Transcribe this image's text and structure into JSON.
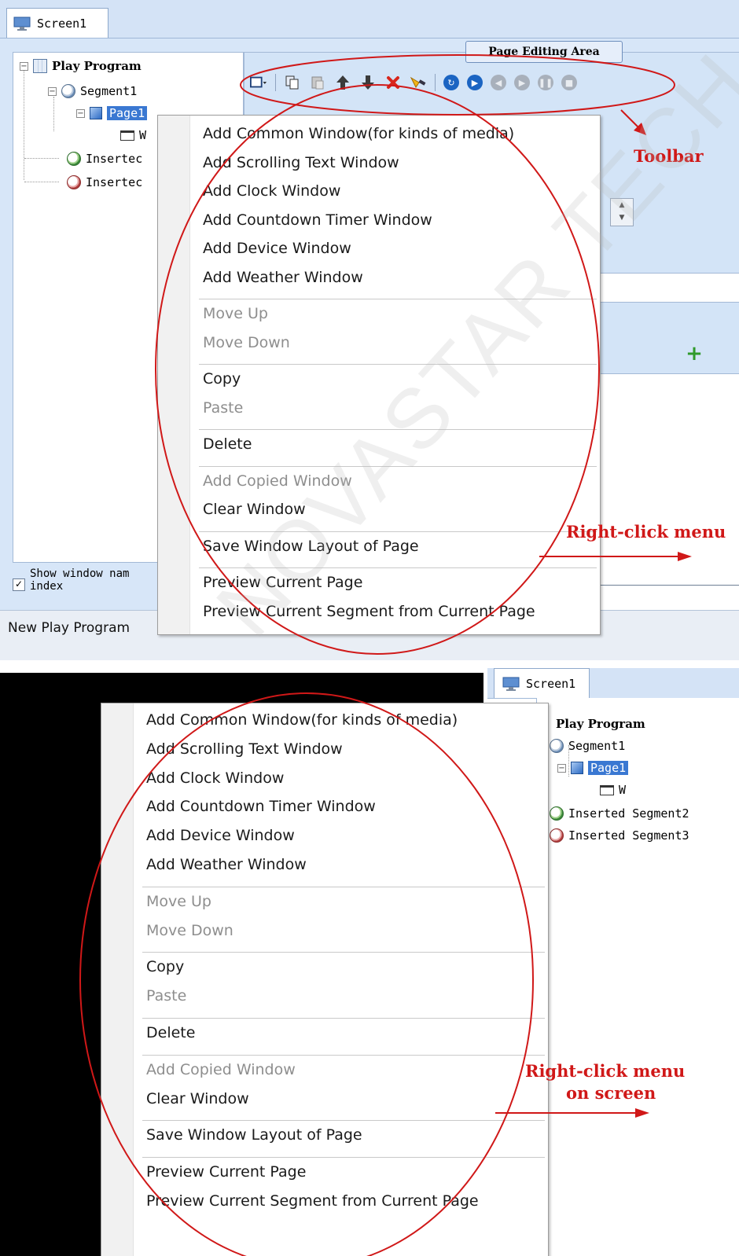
{
  "top": {
    "tab": {
      "icon": "monitor-icon",
      "label": "Screen1"
    },
    "tree": {
      "root": "Play Program",
      "segment1": "Segment1",
      "page1": "Page1",
      "window": "W",
      "inserted_a": "Insertec",
      "inserted_b": "Insertec"
    },
    "checkbox": {
      "checked": true,
      "line1": "Show window nam",
      "line2": "index"
    },
    "status": "New Play Program",
    "page_editing_area": "Page Editing Area",
    "toolbar_icons": [
      "add-window-dropdown-icon",
      "copy-icon",
      "paste-icon",
      "move-up-icon",
      "move-down-icon",
      "delete-icon",
      "clear-icon",
      "preview-segment-icon",
      "play-icon",
      "prev-icon",
      "next-icon",
      "pause-icon",
      "stop-icon"
    ],
    "annotation_toolbar": "Toolbar",
    "annotation_menu": "Right-click menu"
  },
  "menu": {
    "items": [
      {
        "label": "Add Common Window(for kinds of media)",
        "enabled": true
      },
      {
        "label": "Add Scrolling Text Window",
        "enabled": true
      },
      {
        "label": "Add Clock Window",
        "enabled": true
      },
      {
        "label": "Add Countdown Timer Window",
        "enabled": true
      },
      {
        "label": "Add Device Window",
        "enabled": true
      },
      {
        "label": "Add Weather Window",
        "enabled": true
      },
      {
        "label": "Move Up",
        "enabled": false
      },
      {
        "label": "Move Down",
        "enabled": false
      },
      {
        "label": "Copy",
        "enabled": true
      },
      {
        "label": "Paste",
        "enabled": false
      },
      {
        "label": "Delete",
        "enabled": true
      },
      {
        "label": "Add Copied Window",
        "enabled": false
      },
      {
        "label": "Clear Window",
        "enabled": true
      },
      {
        "label": "Save Window Layout of Page",
        "enabled": true
      },
      {
        "label": "Preview Current Page",
        "enabled": true
      },
      {
        "label": "Preview Current Segment from Current Page",
        "enabled": true
      }
    ]
  },
  "bottom": {
    "tab": {
      "icon": "monitor-icon",
      "label": "Screen1"
    },
    "tree": {
      "root": "Play Program",
      "segment1": "Segment1",
      "page1": "Page1",
      "window": "W",
      "inserted2": "Inserted Segment2",
      "inserted3": "Inserted Segment3"
    },
    "annotation_line1": "Right-click menu",
    "annotation_line2": "on screen"
  },
  "watermark": "NOVASTAR TECH CO., L",
  "colors": {
    "annotation": "#d01818",
    "selection": "#3a78d2",
    "panel": "#d3e4f7"
  }
}
